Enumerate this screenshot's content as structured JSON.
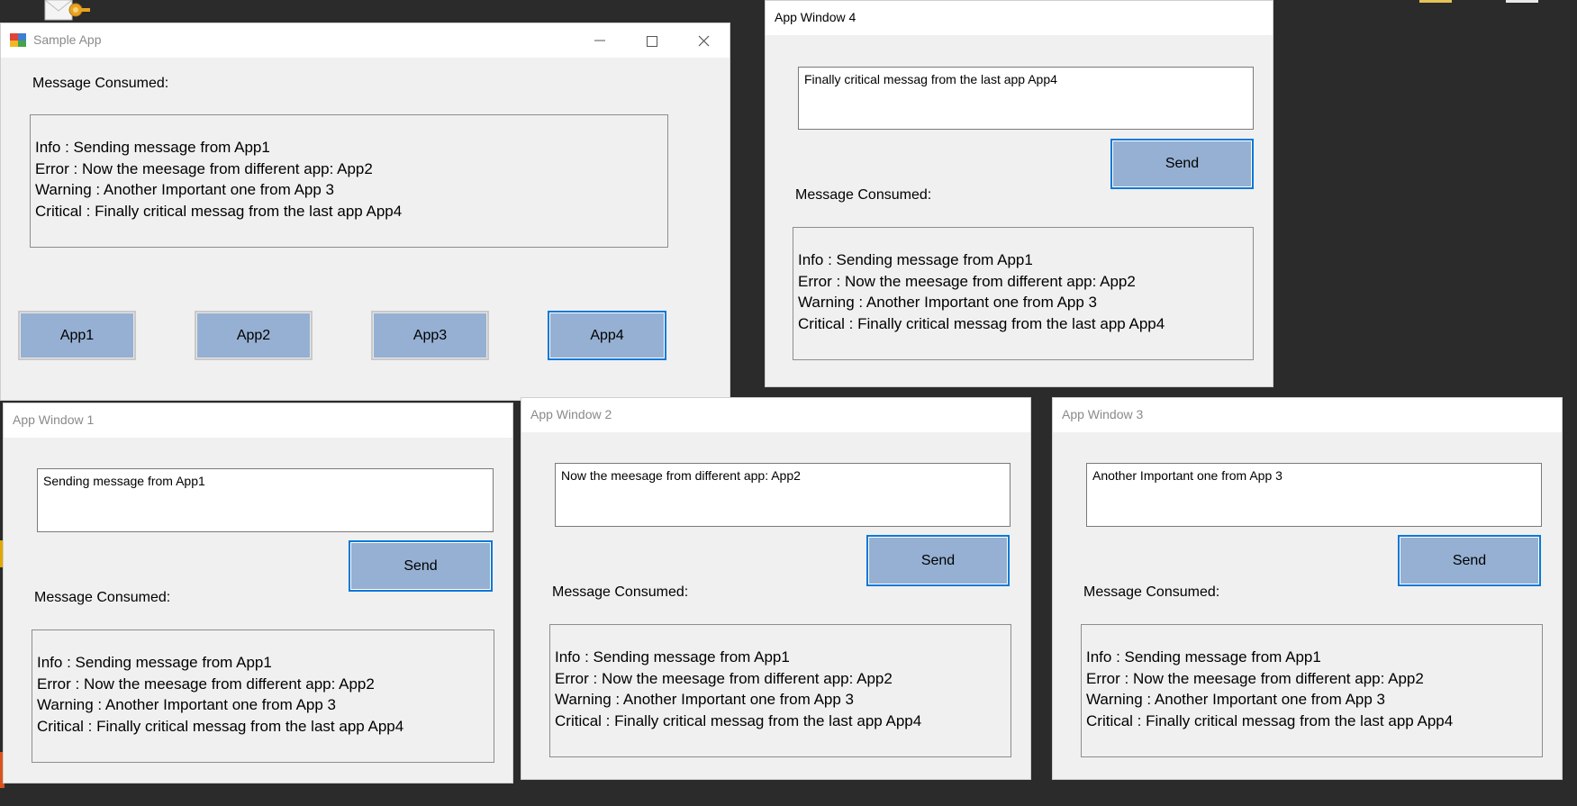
{
  "sample_app": {
    "title": "Sample App",
    "message_label": "Message Consumed:",
    "messages": [
      "Info : Sending message from App1",
      "Error : Now the meesage from different app: App2",
      "Warning : Another Important one from App 3",
      "Critical : Finally critical messag from the last app App4"
    ],
    "buttons": [
      "App1",
      "App2",
      "App3",
      "App4"
    ]
  },
  "window4": {
    "title": "App Window 4",
    "input_value": "Finally critical messag from the last app App4",
    "send_label": "Send",
    "message_label": "Message Consumed:",
    "messages": [
      "Info : Sending message from App1",
      "Error : Now the meesage from different app: App2",
      "Warning : Another Important one from App 3",
      "Critical : Finally critical messag from the last app App4"
    ]
  },
  "window1": {
    "title": "App Window 1",
    "input_value": "Sending message from App1",
    "send_label": "Send",
    "message_label": "Message Consumed:",
    "messages": [
      "Info : Sending message from App1",
      "Error : Now the meesage from different app: App2",
      "Warning : Another Important one from App 3",
      "Critical : Finally critical messag from the last app App4"
    ]
  },
  "window2": {
    "title": "App Window 2",
    "input_value": "Now the meesage from different app: App2",
    "send_label": "Send",
    "message_label": "Message Consumed:",
    "messages": [
      "Info : Sending message from App1",
      "Error : Now the meesage from different app: App2",
      "Warning : Another Important one from App 3",
      "Critical : Finally critical messag from the last app App4"
    ]
  },
  "window3": {
    "title": "App Window 3",
    "input_value": "Another Important one from App 3",
    "send_label": "Send",
    "message_label": "Message Consumed:",
    "messages": [
      "Info : Sending message from App1",
      "Error : Now the meesage from different app: App2",
      "Warning : Another Important one from App 3",
      "Critical : Finally critical messag from the last app App4"
    ]
  },
  "icons": {
    "desktop_shortcut": "mail-key-icon",
    "sample_app_icon": "app-window-icon"
  },
  "colors": {
    "desktop": "#2b2b2b",
    "window_bg": "#f0f0f0",
    "button_bg": "#95b0d2",
    "focus_border": "#0a78d7"
  }
}
